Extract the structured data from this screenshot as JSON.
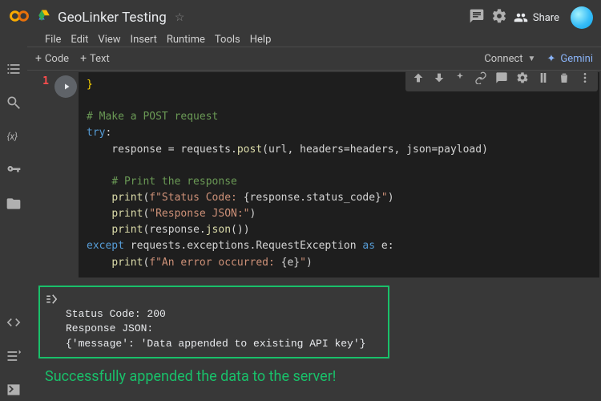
{
  "header": {
    "doc_title": "GeoLinker Testing",
    "share_label": "Share",
    "menus": [
      "File",
      "Edit",
      "View",
      "Insert",
      "Runtime",
      "Tools",
      "Help"
    ]
  },
  "strip": {
    "code_label": "Code",
    "text_label": "Text",
    "connect_label": "Connect",
    "gemini_label": "Gemini"
  },
  "cell": {
    "line_no": "1",
    "code": {
      "l0": "}",
      "c1": "# Make a POST request",
      "k_try": "try",
      "l3a": "    response = requests.",
      "l3fn": "post",
      "l3b": "(url, headers=headers, json=payload)",
      "c2": "# Print the response",
      "p1fn": "print",
      "p1s": "f\"Status Code: ",
      "p1v": "{response.status_code}",
      "p1e": "\"",
      "p2fn": "print",
      "p2s": "\"Response JSON:\"",
      "p3fn": "print",
      "p3b": "(response.",
      "p3fnb": "json",
      "p3c": "())",
      "k_exc": "except",
      "exc_a": " requests.exceptions.RequestException ",
      "k_as": "as",
      "exc_b": " e:",
      "p4fn": "print",
      "p4s": "f\"An error occurred: ",
      "p4v": "{e}",
      "p4e": "\""
    }
  },
  "output": {
    "l1": "Status Code: 200",
    "l2": "Response JSON:",
    "l3": "{'message': 'Data appended to existing API key'}"
  },
  "annotation": "Successfully appended the data to the server!"
}
